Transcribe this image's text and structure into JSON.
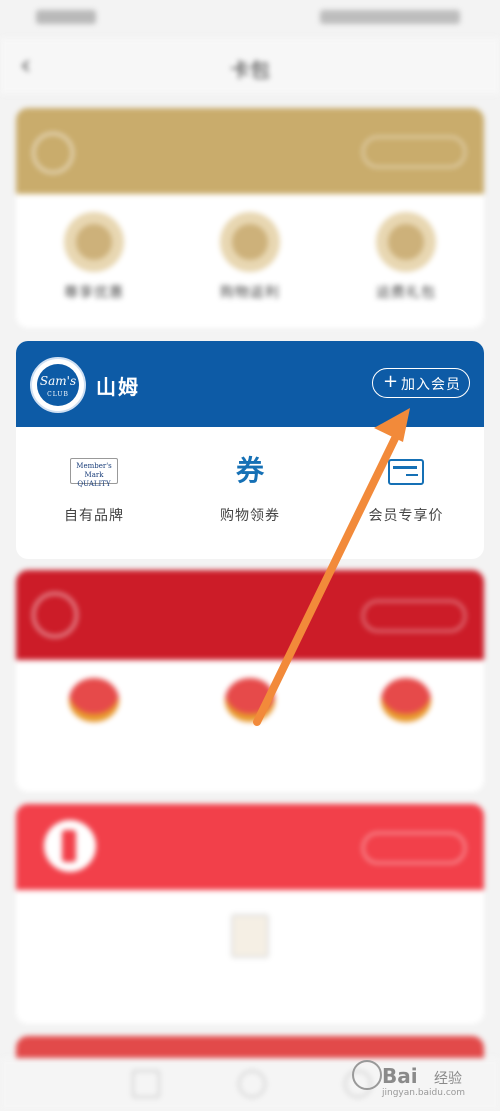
{
  "nav": {
    "title": "卡包"
  },
  "gold_card": {
    "head_title": "",
    "head_button": "",
    "items": [
      {
        "label": "尊享优惠"
      },
      {
        "label": "购物返利"
      },
      {
        "label": "运费礼包"
      }
    ]
  },
  "sams_card": {
    "logo_line1": "Sam's",
    "logo_line2": "CLUB",
    "title": "山姆",
    "join_button": "加入会员",
    "join_icon": "plus-icon",
    "items": [
      {
        "label": "自有品牌",
        "icon": "members-mark-icon"
      },
      {
        "label": "购物领券",
        "icon": "coupon-icon",
        "glyph": "券"
      },
      {
        "label": "会员专享价",
        "icon": "member-card-icon"
      }
    ]
  },
  "red_card": {
    "items": [
      {
        "label": ""
      },
      {
        "label": ""
      },
      {
        "label": ""
      }
    ]
  },
  "pink_card": {
    "item_label": ""
  },
  "watermark": {
    "brand": "Bai",
    "brand_cn": "经验",
    "url": "jingyan.baidu.com"
  },
  "colors": {
    "sams_blue": "#0d5ba6",
    "gold": "#c9ac6c",
    "red": "#cc1c28",
    "arrow": "#f28a3a"
  }
}
